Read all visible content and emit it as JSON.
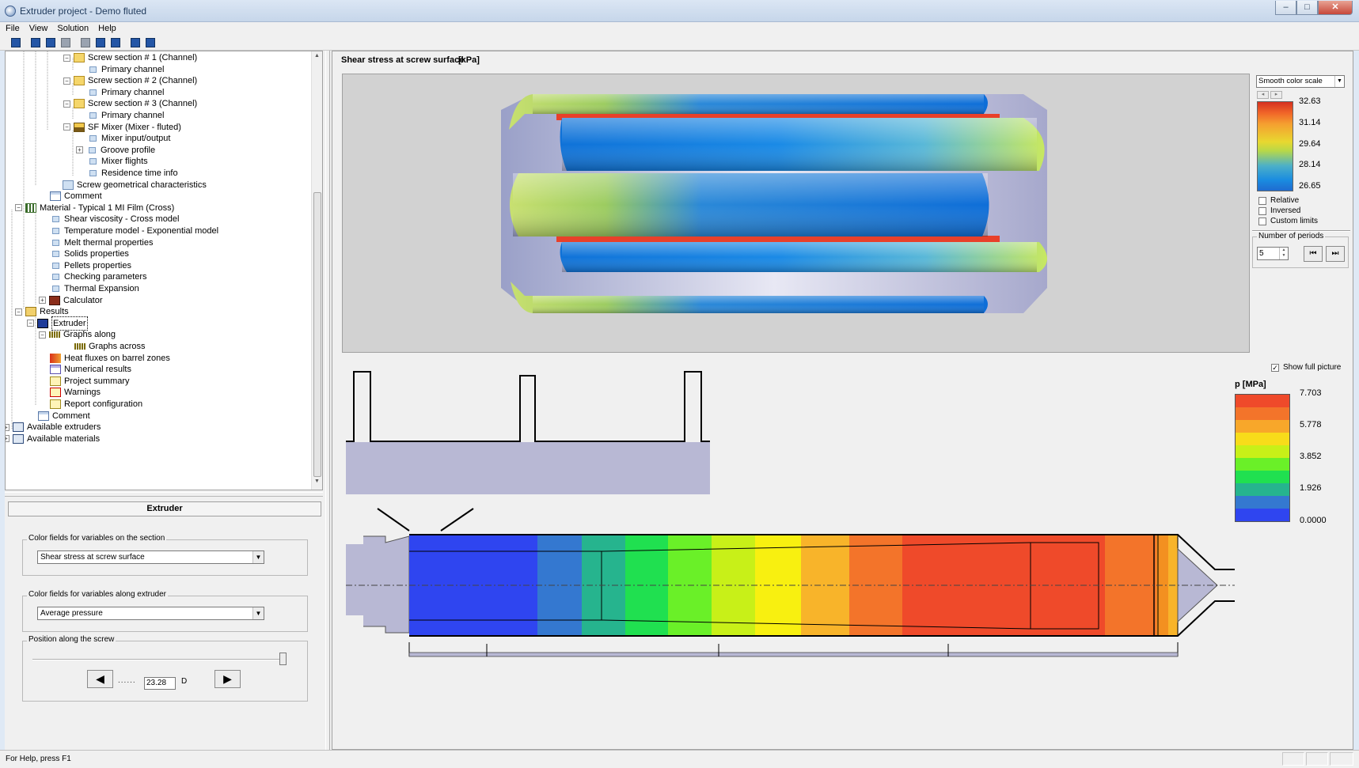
{
  "window": {
    "title": "Extruder project - Demo fluted",
    "minimize": "–",
    "maximize": "□",
    "close": "✕"
  },
  "menu": [
    "File",
    "View",
    "Solution",
    "Help"
  ],
  "toolbar_icons": [
    "save-icon",
    "save-all-icon",
    "save-as-icon",
    "copy-icon",
    "print-icon",
    "solve-icon",
    "edit-icon",
    "help-icon",
    "context-help-icon"
  ],
  "tree": {
    "items": [
      {
        "label": "Screw section # 1 (Channel)",
        "icon": "folder-icon"
      },
      {
        "label": "Primary channel",
        "icon": "doc-icon"
      },
      {
        "label": "Screw section # 2 (Channel)",
        "icon": "folder-icon"
      },
      {
        "label": "Primary channel",
        "icon": "doc-icon"
      },
      {
        "label": "Screw section # 3 (Channel)",
        "icon": "folder-icon"
      },
      {
        "label": "Primary channel",
        "icon": "doc-icon"
      },
      {
        "label": "SF Mixer (Mixer - fluted)",
        "icon": "mixer-icon"
      },
      {
        "label": "Mixer input/output",
        "icon": "doc-icon"
      },
      {
        "label": "Groove profile",
        "icon": "doc-icon"
      },
      {
        "label": "Mixer flights",
        "icon": "doc-icon"
      },
      {
        "label": "Residence time info",
        "icon": "doc-icon"
      },
      {
        "label": "Screw geometrical characteristics",
        "icon": "geometry-icon"
      },
      {
        "label": "Comment",
        "icon": "comment-icon"
      },
      {
        "label": "Material - Typical 1 MI Film (Cross)",
        "icon": "material-icon"
      },
      {
        "label": "Shear viscosity - Cross model",
        "icon": "doc-icon"
      },
      {
        "label": "Temperature model - Exponential model",
        "icon": "doc-icon"
      },
      {
        "label": "Melt thermal properties",
        "icon": "doc-icon"
      },
      {
        "label": "Solids properties",
        "icon": "doc-icon"
      },
      {
        "label": "Pellets properties",
        "icon": "doc-icon"
      },
      {
        "label": "Checking parameters",
        "icon": "doc-icon"
      },
      {
        "label": "Thermal Expansion",
        "icon": "doc-icon"
      },
      {
        "label": "Calculator",
        "icon": "calculator-icon"
      },
      {
        "label": "Results",
        "icon": "results-icon"
      },
      {
        "label": "Extruder",
        "icon": "extruder-icon"
      },
      {
        "label": "Graphs along",
        "icon": "graph-icon"
      },
      {
        "label": "Graphs across",
        "icon": "graph-icon"
      },
      {
        "label": "Heat fluxes on barrel zones",
        "icon": "heat-icon"
      },
      {
        "label": "Numerical results",
        "icon": "numeric-icon"
      },
      {
        "label": "Project summary",
        "icon": "summary-icon"
      },
      {
        "label": "Warnings",
        "icon": "warning-icon"
      },
      {
        "label": "Report configuration",
        "icon": "report-icon"
      },
      {
        "label": "Comment",
        "icon": "comment-icon"
      },
      {
        "label": "Available extruders",
        "icon": "available-icon"
      },
      {
        "label": "Available materials",
        "icon": "available-icon"
      }
    ]
  },
  "props": {
    "header": "Extruder",
    "section_group_label": "Color fields for variables on the section",
    "section_value": "Shear stress at screw surface",
    "along_group_label": "Color fields for variables along extruder",
    "along_value": "Average pressure",
    "position_group_label": "Position along the screw",
    "position_value": "23.28",
    "position_unit": "D",
    "position_dots": "......",
    "prev_label": "◀",
    "next_label": "▶"
  },
  "view": {
    "title": "Shear stress at screw surface",
    "unit": "[kPa]",
    "scale_mode": "Smooth color scale",
    "scale_labels": [
      "32.63",
      "31.14",
      "29.64",
      "28.14",
      "26.65"
    ],
    "relative_label": "Relative",
    "inversed_label": "Inversed",
    "custom_limits_label": "Custom limits",
    "relative_checked": false,
    "inversed_checked": false,
    "custom_limits_checked": false,
    "periods_label": "Number of periods",
    "periods_value": "5",
    "show_full_label": "Show full picture",
    "show_full_checked": true,
    "check_mark": "✓",
    "pressure_title": "p [MPa]",
    "pressure_labels": [
      "7.703",
      "5.778",
      "3.852",
      "1.926",
      "0.0000"
    ]
  },
  "status": {
    "text": "For Help, press F1"
  }
}
